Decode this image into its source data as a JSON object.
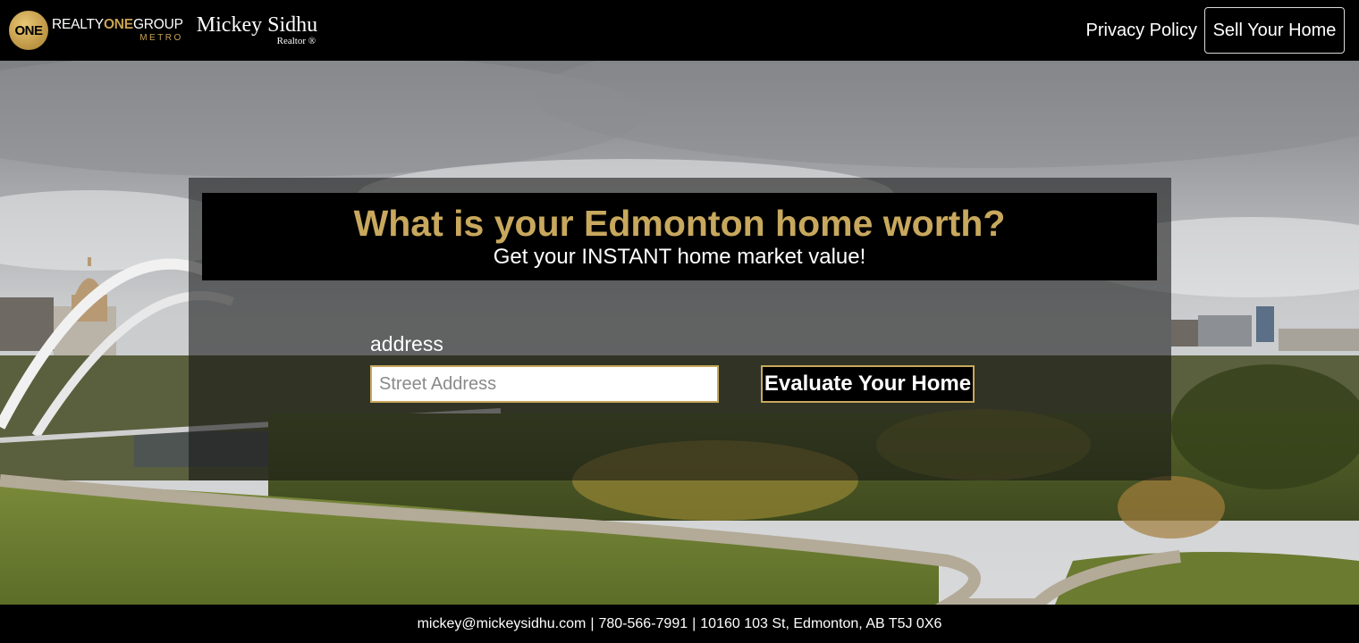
{
  "header": {
    "logo_badge": "ONE",
    "logo_realty": "REALTY",
    "logo_one": "ONE",
    "logo_group": "GROUP",
    "logo_metro": "METRO",
    "agent_name": "Mickey Sidhu",
    "agent_title": "Realtor ®",
    "nav": {
      "privacy_label": "Privacy Policy",
      "sell_label": "Sell Your Home"
    }
  },
  "hero": {
    "headline": "What is your Edmonton home worth?",
    "subheadline": "Get your INSTANT home market value!",
    "form": {
      "address_label": "address",
      "address_placeholder": "Street Address",
      "address_value": "",
      "submit_label": "Evaluate Your Home"
    }
  },
  "footer": {
    "email": "mickey@mickeysidhu.com",
    "phone": "780-566-7991",
    "address": "10160 103 St, Edmonton, AB T5J 0X6",
    "separator": "|"
  },
  "colors": {
    "accent_gold": "#c8a85d",
    "background": "#000000",
    "text": "#ffffff"
  }
}
